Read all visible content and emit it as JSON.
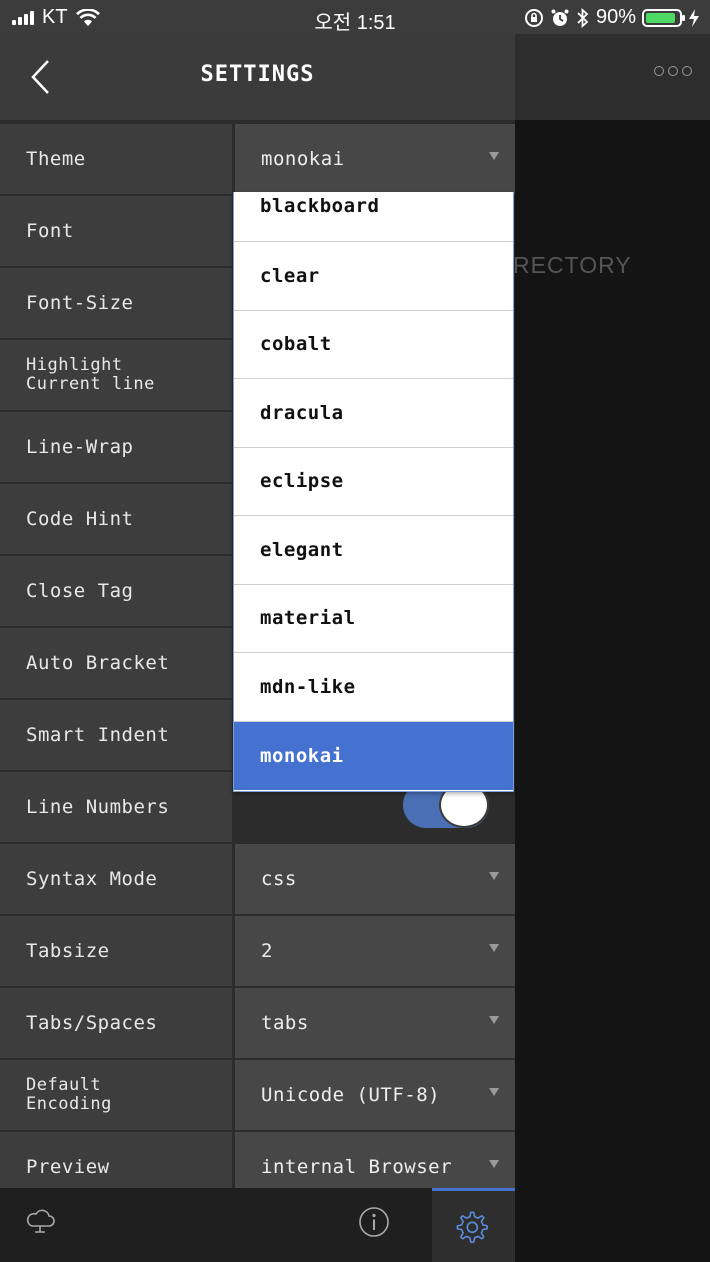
{
  "status_bar": {
    "carrier": "KT",
    "time": "오전 1:51",
    "battery": "90%"
  },
  "header": {
    "title": "SETTINGS"
  },
  "background": {
    "partial_text": "RECTORY"
  },
  "settings": [
    {
      "label": "Theme",
      "value": "monokai"
    },
    {
      "label": "Font",
      "value": ""
    },
    {
      "label": "Font-Size",
      "value": ""
    },
    {
      "label": "Highlight\nCurrent line",
      "value": ""
    },
    {
      "label": "Line-Wrap",
      "value": ""
    },
    {
      "label": "Code Hint",
      "value": ""
    },
    {
      "label": "Close Tag",
      "value": ""
    },
    {
      "label": "Auto Bracket",
      "value": ""
    },
    {
      "label": "Smart Indent",
      "value": ""
    },
    {
      "label": "Line Numbers",
      "value": ""
    },
    {
      "label": "Syntax Mode",
      "value": "css"
    },
    {
      "label": "Tabsize",
      "value": "2"
    },
    {
      "label": "Tabs/Spaces",
      "value": "tabs"
    },
    {
      "label": "Default\nEncoding",
      "value": "Unicode (UTF-8)"
    },
    {
      "label": "Preview",
      "value": "internal Browser"
    }
  ],
  "theme_options": [
    "blackboard",
    "clear",
    "cobalt",
    "dracula",
    "eclipse",
    "elegant",
    "material",
    "mdn-like",
    "monokai"
  ],
  "selected_theme": "monokai",
  "line_numbers_on": true,
  "colors": {
    "accent": "#4571d0",
    "toggle": "#4a6fb5",
    "panel": "#2c2c2c"
  },
  "tab_bar": {
    "icons": [
      "cloud-icon",
      "info-icon",
      "gear-icon"
    ]
  }
}
